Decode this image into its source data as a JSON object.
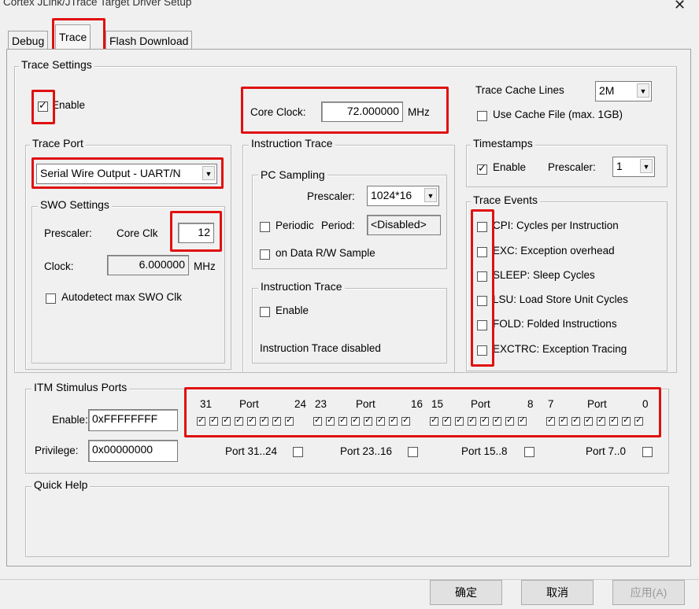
{
  "window": {
    "title": "Cortex JLink/JTrace Target Driver Setup",
    "close_icon": "close-icon"
  },
  "tabs": [
    {
      "label": "Debug",
      "active": false
    },
    {
      "label": "Trace",
      "active": true
    },
    {
      "label": "Flash Download",
      "active": false
    }
  ],
  "trace_settings": {
    "legend": "Trace Settings",
    "enable_label": "Enable",
    "enable_checked": true,
    "core_clock_label": "Core Clock:",
    "core_clock_value": "72.000000",
    "core_clock_unit": "MHz",
    "cache_lines_label": "Trace Cache Lines",
    "cache_lines_value": "2M",
    "use_cache_file_label": "Use Cache File (max. 1GB)",
    "use_cache_file_checked": false
  },
  "trace_port": {
    "legend": "Trace Port",
    "value": "Serial Wire Output - UART/N",
    "swo_legend": "SWO Settings",
    "prescaler_label": "Prescaler:",
    "core_clk_label": "Core Clk",
    "prescaler_value": "12",
    "clock_label": "Clock:",
    "clock_value": "6.000000",
    "clock_unit": "MHz",
    "autodetect_label": "Autodetect max SWO Clk",
    "autodetect_checked": false
  },
  "instruction_trace_outer": {
    "legend": "Instruction Trace",
    "pc_legend": "PC Sampling",
    "prescaler_label": "Prescaler:",
    "prescaler_value": "1024*16",
    "periodic_label": "Periodic",
    "period_label": "Period:",
    "period_value": "<Disabled>",
    "periodic_checked": false,
    "on_data_label": "on Data R/W Sample",
    "on_data_checked": false,
    "inner_legend": "Instruction Trace",
    "enable_label": "Enable",
    "enable_checked": false,
    "status": "Instruction Trace disabled"
  },
  "timestamps": {
    "legend": "Timestamps",
    "enable_label": "Enable",
    "enable_checked": true,
    "prescaler_label": "Prescaler:",
    "prescaler_value": "1"
  },
  "trace_events": {
    "legend": "Trace Events",
    "items": [
      {
        "label": "CPI: Cycles per Instruction",
        "checked": false
      },
      {
        "label": "EXC: Exception overhead",
        "checked": false
      },
      {
        "label": "SLEEP: Sleep Cycles",
        "checked": false
      },
      {
        "label": "LSU: Load Store Unit Cycles",
        "checked": false
      },
      {
        "label": "FOLD: Folded Instructions",
        "checked": false
      },
      {
        "label": "EXCTRC: Exception Tracing",
        "checked": false
      }
    ]
  },
  "itm": {
    "legend": "ITM Stimulus Ports",
    "enable_label": "Enable:",
    "enable_value": "0xFFFFFFFF",
    "privilege_label": "Privilege:",
    "privilege_value": "0x00000000",
    "groups": [
      {
        "hi": "31",
        "port": "Port",
        "lo": "24",
        "priv_label": "Port 31..24"
      },
      {
        "hi": "23",
        "port": "Port",
        "lo": "16",
        "priv_label": "Port 23..16"
      },
      {
        "hi": "15",
        "port": "Port",
        "lo": "8",
        "priv_label": "Port 15..8"
      },
      {
        "hi": "7",
        "port": "Port",
        "lo": "0",
        "priv_label": "Port 7..0"
      }
    ]
  },
  "quick_help": {
    "legend": "Quick Help"
  },
  "buttons": {
    "ok": "确定",
    "cancel": "取消",
    "apply": "应用(A)"
  },
  "colors": {
    "highlight": "#e01010",
    "background": "#f0f0f0"
  }
}
